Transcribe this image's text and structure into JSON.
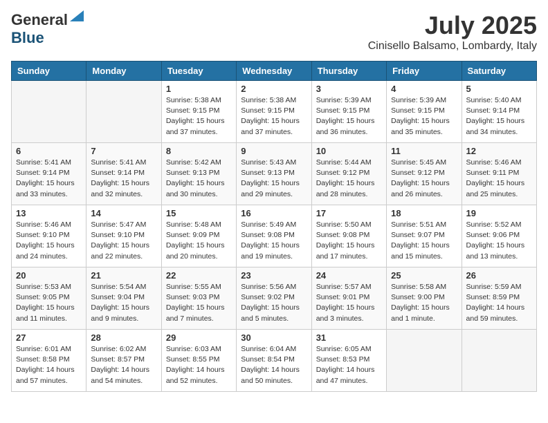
{
  "logo": {
    "general": "General",
    "blue": "Blue"
  },
  "title": "July 2025",
  "location": "Cinisello Balsamo, Lombardy, Italy",
  "days_of_week": [
    "Sunday",
    "Monday",
    "Tuesday",
    "Wednesday",
    "Thursday",
    "Friday",
    "Saturday"
  ],
  "weeks": [
    [
      {
        "day": "",
        "info": ""
      },
      {
        "day": "",
        "info": ""
      },
      {
        "day": "1",
        "info": "Sunrise: 5:38 AM\nSunset: 9:15 PM\nDaylight: 15 hours and 37 minutes."
      },
      {
        "day": "2",
        "info": "Sunrise: 5:38 AM\nSunset: 9:15 PM\nDaylight: 15 hours and 37 minutes."
      },
      {
        "day": "3",
        "info": "Sunrise: 5:39 AM\nSunset: 9:15 PM\nDaylight: 15 hours and 36 minutes."
      },
      {
        "day": "4",
        "info": "Sunrise: 5:39 AM\nSunset: 9:15 PM\nDaylight: 15 hours and 35 minutes."
      },
      {
        "day": "5",
        "info": "Sunrise: 5:40 AM\nSunset: 9:14 PM\nDaylight: 15 hours and 34 minutes."
      }
    ],
    [
      {
        "day": "6",
        "info": "Sunrise: 5:41 AM\nSunset: 9:14 PM\nDaylight: 15 hours and 33 minutes."
      },
      {
        "day": "7",
        "info": "Sunrise: 5:41 AM\nSunset: 9:14 PM\nDaylight: 15 hours and 32 minutes."
      },
      {
        "day": "8",
        "info": "Sunrise: 5:42 AM\nSunset: 9:13 PM\nDaylight: 15 hours and 30 minutes."
      },
      {
        "day": "9",
        "info": "Sunrise: 5:43 AM\nSunset: 9:13 PM\nDaylight: 15 hours and 29 minutes."
      },
      {
        "day": "10",
        "info": "Sunrise: 5:44 AM\nSunset: 9:12 PM\nDaylight: 15 hours and 28 minutes."
      },
      {
        "day": "11",
        "info": "Sunrise: 5:45 AM\nSunset: 9:12 PM\nDaylight: 15 hours and 26 minutes."
      },
      {
        "day": "12",
        "info": "Sunrise: 5:46 AM\nSunset: 9:11 PM\nDaylight: 15 hours and 25 minutes."
      }
    ],
    [
      {
        "day": "13",
        "info": "Sunrise: 5:46 AM\nSunset: 9:10 PM\nDaylight: 15 hours and 24 minutes."
      },
      {
        "day": "14",
        "info": "Sunrise: 5:47 AM\nSunset: 9:10 PM\nDaylight: 15 hours and 22 minutes."
      },
      {
        "day": "15",
        "info": "Sunrise: 5:48 AM\nSunset: 9:09 PM\nDaylight: 15 hours and 20 minutes."
      },
      {
        "day": "16",
        "info": "Sunrise: 5:49 AM\nSunset: 9:08 PM\nDaylight: 15 hours and 19 minutes."
      },
      {
        "day": "17",
        "info": "Sunrise: 5:50 AM\nSunset: 9:08 PM\nDaylight: 15 hours and 17 minutes."
      },
      {
        "day": "18",
        "info": "Sunrise: 5:51 AM\nSunset: 9:07 PM\nDaylight: 15 hours and 15 minutes."
      },
      {
        "day": "19",
        "info": "Sunrise: 5:52 AM\nSunset: 9:06 PM\nDaylight: 15 hours and 13 minutes."
      }
    ],
    [
      {
        "day": "20",
        "info": "Sunrise: 5:53 AM\nSunset: 9:05 PM\nDaylight: 15 hours and 11 minutes."
      },
      {
        "day": "21",
        "info": "Sunrise: 5:54 AM\nSunset: 9:04 PM\nDaylight: 15 hours and 9 minutes."
      },
      {
        "day": "22",
        "info": "Sunrise: 5:55 AM\nSunset: 9:03 PM\nDaylight: 15 hours and 7 minutes."
      },
      {
        "day": "23",
        "info": "Sunrise: 5:56 AM\nSunset: 9:02 PM\nDaylight: 15 hours and 5 minutes."
      },
      {
        "day": "24",
        "info": "Sunrise: 5:57 AM\nSunset: 9:01 PM\nDaylight: 15 hours and 3 minutes."
      },
      {
        "day": "25",
        "info": "Sunrise: 5:58 AM\nSunset: 9:00 PM\nDaylight: 15 hours and 1 minute."
      },
      {
        "day": "26",
        "info": "Sunrise: 5:59 AM\nSunset: 8:59 PM\nDaylight: 14 hours and 59 minutes."
      }
    ],
    [
      {
        "day": "27",
        "info": "Sunrise: 6:01 AM\nSunset: 8:58 PM\nDaylight: 14 hours and 57 minutes."
      },
      {
        "day": "28",
        "info": "Sunrise: 6:02 AM\nSunset: 8:57 PM\nDaylight: 14 hours and 54 minutes."
      },
      {
        "day": "29",
        "info": "Sunrise: 6:03 AM\nSunset: 8:55 PM\nDaylight: 14 hours and 52 minutes."
      },
      {
        "day": "30",
        "info": "Sunrise: 6:04 AM\nSunset: 8:54 PM\nDaylight: 14 hours and 50 minutes."
      },
      {
        "day": "31",
        "info": "Sunrise: 6:05 AM\nSunset: 8:53 PM\nDaylight: 14 hours and 47 minutes."
      },
      {
        "day": "",
        "info": ""
      },
      {
        "day": "",
        "info": ""
      }
    ]
  ]
}
